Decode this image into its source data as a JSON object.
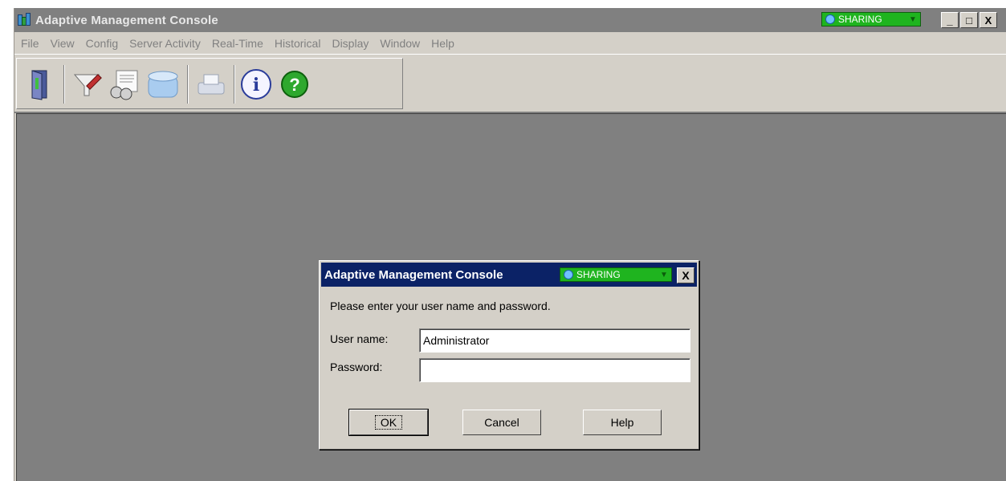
{
  "app": {
    "title": "Adaptive Management Console",
    "sharing_label": "SHARING",
    "caption_buttons": {
      "minimize": "_",
      "maximize": "□",
      "close": "X"
    }
  },
  "menu": [
    "File",
    "View",
    "Config",
    "Server Activity",
    "Real-Time",
    "Historical",
    "Display",
    "Window",
    "Help"
  ],
  "toolbar": {
    "buttons": [
      "exit-door-icon",
      "filter-edit-icon",
      "report-binoculars-icon",
      "database-icon",
      "printer-icon",
      "info-icon",
      "help-icon"
    ],
    "help_glyph": "?",
    "info_glyph": "i"
  },
  "dialog": {
    "title": "Adaptive Management Console",
    "sharing_label": "SHARING",
    "close_label": "X",
    "prompt": "Please enter your user name and password.",
    "username_label": "User name:",
    "username_value": "Administrator",
    "password_label": "Password:",
    "password_value": "",
    "ok_label": "OK",
    "cancel_label": "Cancel",
    "help_label": "Help"
  },
  "colors": {
    "title_inactive": "#808080",
    "dialog_title": "#0b2266",
    "sharing_green": "#1fb41f",
    "client_bg": "#808080",
    "face": "#d4d0c8"
  }
}
